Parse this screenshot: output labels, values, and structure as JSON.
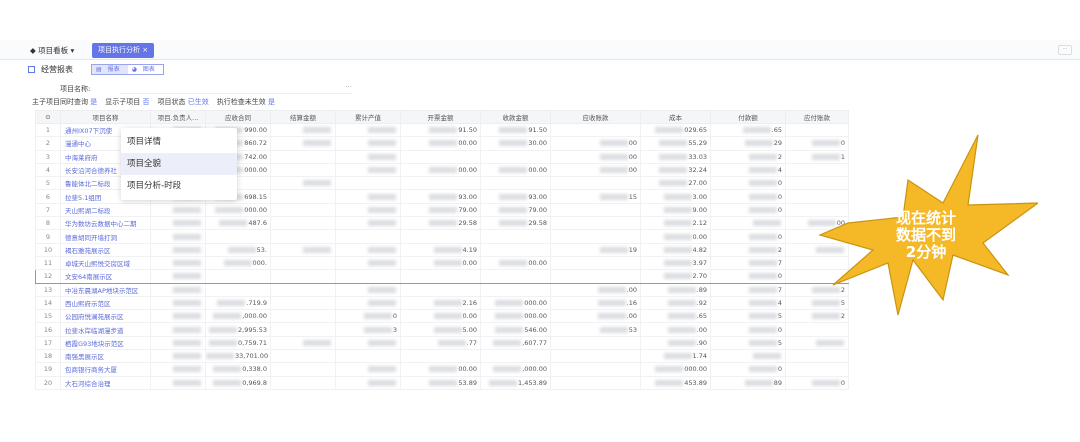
{
  "tabs": {
    "menu": "项目看板",
    "active": "项目执行分析 ×"
  },
  "subheader": {
    "title": "经营报表",
    "view_table": "报表",
    "view_chart": "图表"
  },
  "filter": {
    "label": "项目名称:",
    "ellipsis": "···"
  },
  "options": [
    {
      "label": "主子项目同时查询",
      "value": "是"
    },
    {
      "label": "显示子项目",
      "value": "否"
    },
    {
      "label": "项目状态",
      "value": "已生效"
    },
    {
      "label": "执行检查未生效",
      "value": "是"
    }
  ],
  "columns": [
    "项目名称",
    "项目.负责人...",
    "应收合同",
    "结算金额",
    "累计产值",
    "开票金额",
    "收款金额",
    "应收账款",
    "成本",
    "付款额",
    "应付账款"
  ],
  "rows": [
    [
      "1",
      "通州IX07下沉使",
      "~",
      "990.00",
      "~",
      "~",
      "91.50",
      "91.50",
      "",
      "029.65",
      ".65",
      ""
    ],
    [
      "2",
      "漫通中心",
      "~",
      "860.72",
      "~",
      "~",
      "00.00",
      "30.00",
      "00",
      "55.29",
      "29",
      "0"
    ],
    [
      "3",
      "中海莱府府",
      "~",
      "742.00",
      "",
      "~",
      "",
      "",
      "00",
      "33.03",
      "2",
      "1"
    ],
    [
      "4",
      "长安沿河合德养社",
      "~",
      "000.00",
      "",
      "~",
      "00.00",
      "00.00",
      "00",
      "32.24",
      "4",
      ""
    ],
    [
      "5",
      "鲁能体北二标段",
      "~",
      "",
      "~",
      "",
      "",
      "",
      "",
      "27.00",
      "0",
      ""
    ],
    [
      "6",
      "拉斐5.1组团",
      "~",
      "698.15",
      "",
      "~",
      "93.00",
      "93.00",
      "15",
      "3.00",
      "0",
      ""
    ],
    [
      "7",
      "天山熙湖二标段",
      "~",
      "000.00",
      "",
      "~",
      "79.00",
      "79.00",
      "",
      "9.00",
      "0",
      ""
    ],
    [
      "8",
      "华为数坊云数据中心二期",
      "~",
      "487.6",
      "",
      "~",
      "29.58",
      "29.58",
      "",
      "2.12",
      "~",
      "00"
    ],
    [
      "9",
      "德意胡同开墙打洞",
      "~",
      "",
      "",
      "",
      "",
      "",
      "",
      "0.00",
      "0",
      ""
    ],
    [
      "10",
      "褐石雅苑展示区",
      "~",
      "53.",
      "~",
      "~",
      "4.19",
      "",
      "19",
      "4.82",
      "2",
      "~"
    ],
    [
      "11",
      "卓城天山熙悦交房区域",
      "~",
      "000.",
      "",
      "~",
      "0.00",
      "00.00",
      "",
      "3.97",
      "7",
      ""
    ],
    [
      "12",
      "文安64南展示区",
      "~",
      "",
      "",
      "",
      "",
      "",
      "",
      "2.70",
      "0",
      ""
    ],
    [
      "13",
      "中冶东晨湖AP地块示范区",
      "~",
      "",
      "",
      "~",
      "",
      "",
      ".00",
      ".89",
      "7",
      "2"
    ],
    [
      "14",
      "西山熙府示范区",
      "~",
      ".719.9",
      "",
      "~",
      "2.16",
      "000.00",
      ".16",
      ".92",
      "4",
      "5"
    ],
    [
      "15",
      "公园府悦澜苑展示区",
      "~",
      ",000.00",
      "",
      "0",
      "0.00",
      "000.00",
      ".00",
      ".65",
      "5",
      "2"
    ],
    [
      "16",
      "拉斐水岸临湖漫步道",
      "~",
      "2,995.53",
      "",
      "3",
      "5.00",
      "546.00",
      "53",
      ".00",
      "0",
      ""
    ],
    [
      "17",
      "栖霞G93地块示范区",
      "~",
      "0,759.71",
      "~",
      "~",
      ".77",
      ",607.77",
      "",
      ".90",
      "5",
      "~"
    ],
    [
      "18",
      "南强黑展示区",
      "~",
      "33,701.00",
      "",
      "",
      "",
      "",
      "",
      "1.74",
      "~",
      ""
    ],
    [
      "19",
      "包商银行商务大厦",
      "~",
      "0,338.0",
      "",
      "~",
      "00.00",
      ",000.00",
      "",
      "000.00",
      "0",
      ""
    ],
    [
      "20",
      "大石河综合治理",
      "~",
      "0,969.8",
      "",
      "~",
      "53.89",
      "1,453.89",
      "",
      "453.89",
      "89",
      "0"
    ]
  ],
  "selected_row": "12",
  "context_menu": [
    "项目详情",
    "项目全貌",
    "项目分析-时段"
  ],
  "callout": {
    "lines": [
      "现在统计",
      "数据不到",
      "2分钟"
    ],
    "color": "#f5b826"
  }
}
